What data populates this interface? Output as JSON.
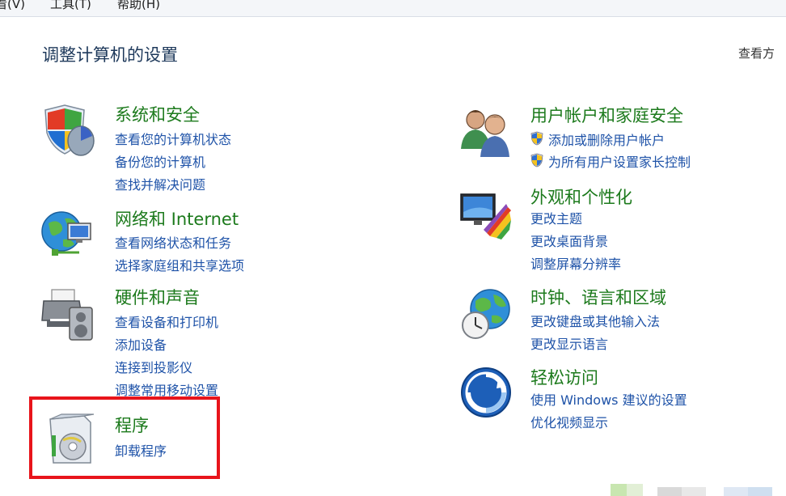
{
  "menu": {
    "view": "看(V)",
    "tools": "工具(T)",
    "help": "帮助(H)"
  },
  "page": {
    "title": "调整计算机的设置",
    "view_by": "查看方"
  },
  "categories": {
    "system_security": {
      "title": "系统和安全",
      "links": [
        "查看您的计算机状态",
        "备份您的计算机",
        "查找并解决问题"
      ]
    },
    "network": {
      "title": "网络和 Internet",
      "links": [
        "查看网络状态和任务",
        "选择家庭组和共享选项"
      ]
    },
    "hardware": {
      "title": "硬件和声音",
      "links": [
        "查看设备和打印机",
        "添加设备",
        "连接到投影仪",
        "调整常用移动设置"
      ]
    },
    "programs": {
      "title": "程序",
      "links": [
        "卸载程序"
      ]
    },
    "user_accounts": {
      "title": "用户帐户和家庭安全",
      "links": [
        "添加或删除用户帐户",
        "为所有用户设置家长控制"
      ]
    },
    "appearance": {
      "title": "外观和个性化",
      "links": [
        "更改主题",
        "更改桌面背景",
        "调整屏幕分辨率"
      ]
    },
    "clock_region": {
      "title": "时钟、语言和区域",
      "links": [
        "更改键盘或其他输入法",
        "更改显示语言"
      ]
    },
    "ease_access": {
      "title": "轻松访问",
      "links": [
        "使用 Windows 建议的设置",
        "优化视频显示"
      ]
    }
  },
  "colors": {
    "title_green": "#1c7a1c",
    "link_blue": "#1f53a8",
    "highlight_red": "#e8141b"
  }
}
